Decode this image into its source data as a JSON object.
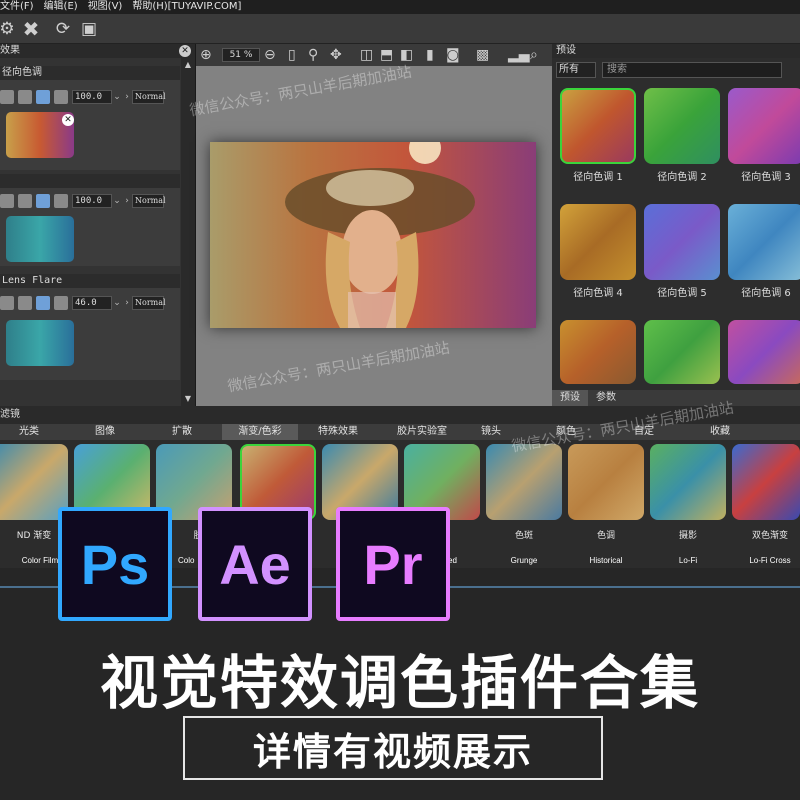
{
  "menu": {
    "items": [
      "文件(F)",
      "编辑(E)",
      "视图(V)",
      "帮助(H)"
    ],
    "site": "[TUYAVIP.COM]"
  },
  "left_panel": {
    "title": "效果",
    "effects": [
      {
        "name": "径向色调",
        "value": "100.0",
        "blend": "Normal"
      },
      {
        "name": "",
        "value": "100.0",
        "blend": "Normal"
      },
      {
        "name": "Lens Flare",
        "value": "46.0",
        "blend": "Normal"
      }
    ]
  },
  "preview": {
    "zoom": "51 %"
  },
  "right_panel": {
    "title": "预设",
    "filter_value": "所有",
    "search_placeholder": "搜索",
    "presets": [
      "径向色调 1",
      "径向色调 2",
      "径向色调 3",
      "径向色调 4",
      "径向色调 5",
      "径向色调 6",
      "",
      "",
      ""
    ],
    "tabs": [
      "预设",
      "参数"
    ]
  },
  "filters": {
    "title": "滤镜",
    "categories": [
      "光类",
      "图像",
      "扩散",
      "渐变/色彩",
      "特殊效果",
      "胶片实验室",
      "镜头",
      "颜色",
      "自定",
      "收藏"
    ],
    "items": [
      {
        "label": "ND 渐变",
        "sub": "Color Film"
      },
      {
        "label": "",
        "sub": ""
      },
      {
        "label": "肤",
        "sub": "Colo"
      },
      {
        "label": "",
        "sub": ""
      },
      {
        "label": "",
        "sub": ""
      },
      {
        "label": "",
        "sub": "ed"
      },
      {
        "label": "色斑",
        "sub": "Grunge"
      },
      {
        "label": "色调",
        "sub": "Historical"
      },
      {
        "label": "摄影",
        "sub": "Lo-Fi"
      },
      {
        "label": "双色渐变",
        "sub": "Lo-Fi Cross"
      }
    ]
  },
  "logos": [
    "Ps",
    "Ae",
    "Pr"
  ],
  "headline": "视觉特效调色插件合集",
  "subheadline": "详情有视频展示",
  "watermarks": [
    "微信公众号：两只山羊后期加油站",
    "微信公众号：两只山羊后期加油站",
    "微信公众号：两只山羊后期加油站"
  ],
  "colors": {
    "ps": "#31a8ff",
    "ae": "#d291ff",
    "pr": "#e77cff",
    "selected": "#3bd43b"
  }
}
